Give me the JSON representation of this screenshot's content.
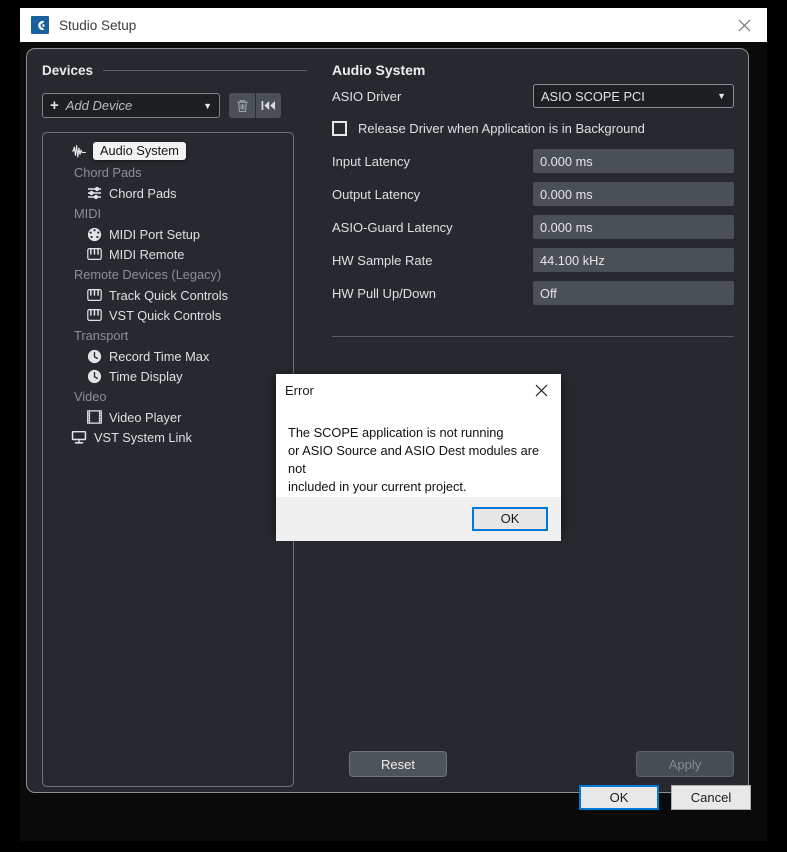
{
  "window": {
    "title": "Studio Setup",
    "app_icon": "cubase-logo-icon",
    "close_icon": "close-icon"
  },
  "devices": {
    "header": "Devices",
    "add_device": {
      "label": "Add Device",
      "plus_icon": "plus-icon",
      "caret_icon": "chevron-down-icon"
    },
    "tools": [
      {
        "name": "delete-device-button",
        "icon": "trash-icon"
      },
      {
        "name": "reset-device-button",
        "icon": "skip-back-icon"
      }
    ],
    "tree": [
      {
        "kind": "item",
        "label": "Audio System",
        "icon": "waveform-icon",
        "selected": true,
        "level": 0
      },
      {
        "kind": "group",
        "label": "Chord Pads"
      },
      {
        "kind": "item",
        "label": "Chord Pads",
        "icon": "sliders-icon",
        "selected": false,
        "level": 1
      },
      {
        "kind": "group",
        "label": "MIDI"
      },
      {
        "kind": "item",
        "label": "MIDI Port Setup",
        "icon": "midi-port-icon",
        "selected": false,
        "level": 1
      },
      {
        "kind": "item",
        "label": "MIDI Remote",
        "icon": "keyboard-icon",
        "selected": false,
        "level": 1
      },
      {
        "kind": "group",
        "label": "Remote Devices (Legacy)"
      },
      {
        "kind": "item",
        "label": "Track Quick Controls",
        "icon": "keyboard-icon",
        "selected": false,
        "level": 1
      },
      {
        "kind": "item",
        "label": "VST Quick Controls",
        "icon": "keyboard-icon",
        "selected": false,
        "level": 1
      },
      {
        "kind": "group",
        "label": "Transport"
      },
      {
        "kind": "item",
        "label": "Record Time Max",
        "icon": "clock-icon",
        "selected": false,
        "level": 1
      },
      {
        "kind": "item",
        "label": "Time Display",
        "icon": "clock-icon",
        "selected": false,
        "level": 1
      },
      {
        "kind": "group",
        "label": "Video"
      },
      {
        "kind": "item",
        "label": "Video Player",
        "icon": "film-icon",
        "selected": false,
        "level": 1
      },
      {
        "kind": "item",
        "label": "VST System Link",
        "icon": "monitor-icon",
        "selected": false,
        "level": 0
      }
    ]
  },
  "audio_system": {
    "title": "Audio System",
    "asio_driver": {
      "label": "ASIO Driver",
      "value": "ASIO SCOPE PCI",
      "caret_icon": "chevron-down-icon"
    },
    "release_driver": {
      "label": "Release Driver when Application is in Background",
      "checked": false
    },
    "fields": [
      {
        "label": "Input Latency",
        "value": "0.000 ms"
      },
      {
        "label": "Output Latency",
        "value": "0.000 ms"
      },
      {
        "label": "ASIO-Guard Latency",
        "value": "0.000 ms"
      },
      {
        "label": "HW Sample Rate",
        "value": "44.100 kHz"
      },
      {
        "label": "HW Pull Up/Down",
        "value": "Off"
      }
    ],
    "reset_label": "Reset",
    "apply_label": "Apply"
  },
  "footer": {
    "ok_label": "OK",
    "cancel_label": "Cancel"
  },
  "error_dialog": {
    "title": "Error",
    "close_icon": "close-icon",
    "message": "The SCOPE application is not running\nor ASIO Source and ASIO Dest modules are not\nincluded in your current project.",
    "ok_label": "OK"
  },
  "colors": {
    "accent_blue": "#0078d7",
    "panel_bg": "#262a2e",
    "window_bg": "#0a0a0a",
    "titlebar_bg": "#ffffff",
    "field_bg": "#4b5055",
    "icon_blue": "#1a5f9e"
  }
}
